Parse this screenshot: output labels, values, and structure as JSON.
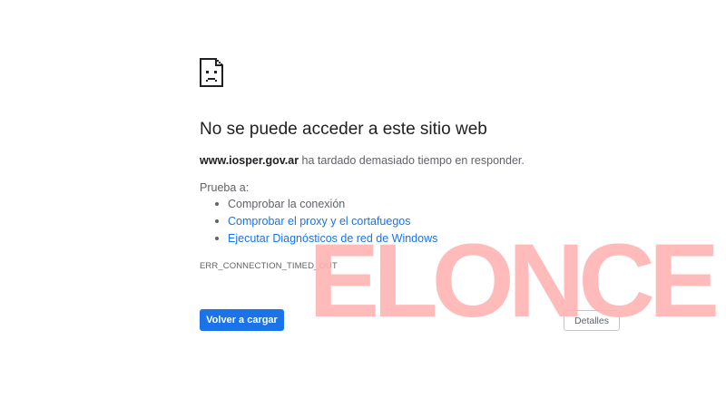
{
  "error_page": {
    "title": "No se puede acceder a este sitio web",
    "host": "www.iosper.gov.ar",
    "description_rest": " ha tardado demasiado tiempo en responder.",
    "try_label": "Prueba a:",
    "suggestions": [
      {
        "label": "Comprobar la conexión",
        "is_link": false
      },
      {
        "label": "Comprobar el proxy y el cortafuegos",
        "is_link": true
      },
      {
        "label": "Ejecutar Diagnósticos de red de Windows",
        "is_link": true
      }
    ],
    "error_code": "ERR_CONNECTION_TIMED_OUT",
    "icon": "sad-page-icon"
  },
  "buttons": {
    "reload_label": "Volver a cargar",
    "details_label": "Detalles"
  },
  "watermark": {
    "text": "ELONCE",
    "color": "#ffb3b3"
  },
  "colors": {
    "link": "#1a73e8",
    "primary_button": "#1a73e8",
    "text_secondary": "#5f6368"
  }
}
